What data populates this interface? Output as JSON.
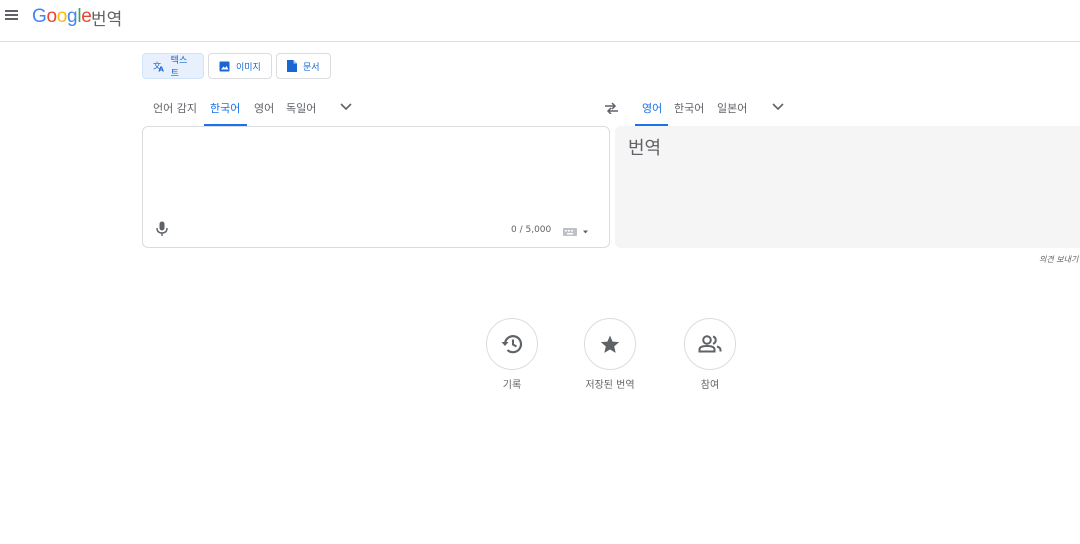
{
  "header": {
    "logo_parts": [
      "G",
      "o",
      "o",
      "g",
      "l",
      "e"
    ],
    "product": "번역",
    "menu_icon": "hamburger-icon"
  },
  "modes": [
    {
      "label": "텍스트",
      "icon": "translate-icon",
      "active": true
    },
    {
      "label": "이미지",
      "icon": "image-icon",
      "active": false
    },
    {
      "label": "문서",
      "icon": "document-icon",
      "active": false
    }
  ],
  "source_langs": [
    {
      "label": "언어 감지",
      "active": false
    },
    {
      "label": "한국어",
      "active": true
    },
    {
      "label": "영어",
      "active": false
    },
    {
      "label": "독일어",
      "active": false
    }
  ],
  "target_langs": [
    {
      "label": "영어",
      "active": true
    },
    {
      "label": "한국어",
      "active": false
    },
    {
      "label": "일본어",
      "active": false
    }
  ],
  "source": {
    "value": "",
    "char_count": "0 / 5,000"
  },
  "target": {
    "placeholder": "번역"
  },
  "feedback": "의견 보내기",
  "actions": [
    {
      "label": "기록",
      "icon": "history-icon"
    },
    {
      "label": "저장된 번역",
      "icon": "star-icon"
    },
    {
      "label": "참여",
      "icon": "people-icon"
    }
  ],
  "colors": {
    "accent": "#1a73e8",
    "border": "#dadce0",
    "target_bg": "#f5f5f5"
  }
}
